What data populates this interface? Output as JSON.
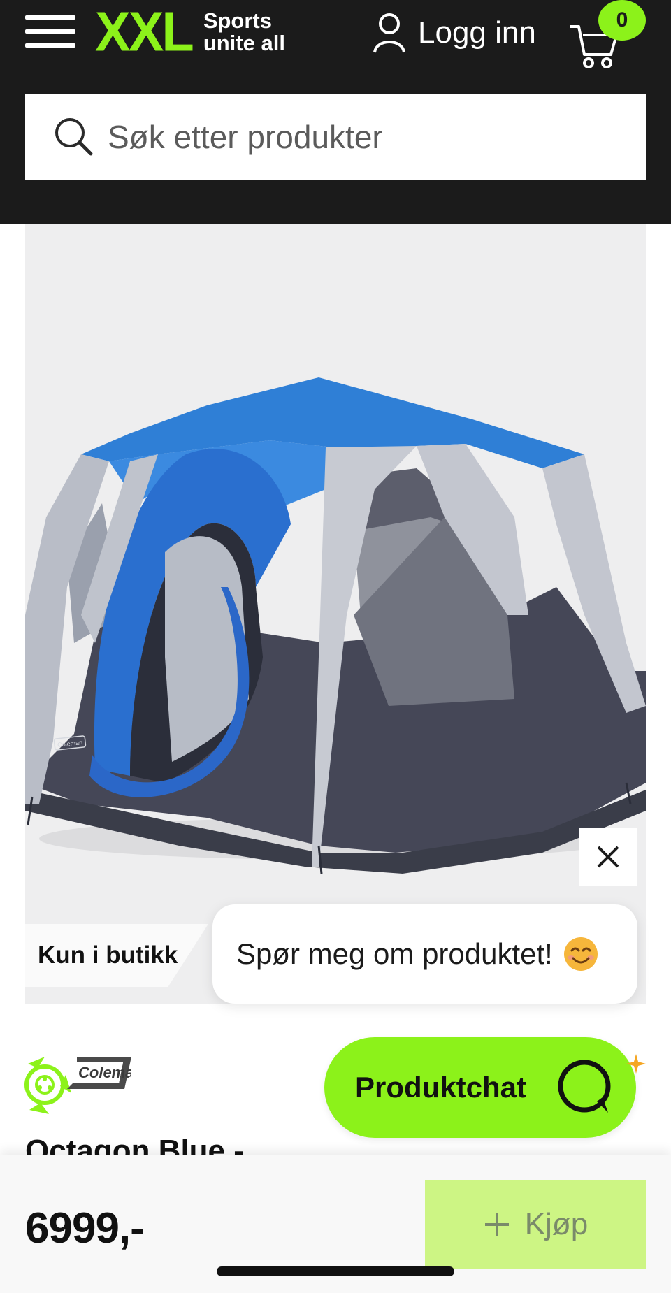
{
  "header": {
    "logo_text": "XXL",
    "tagline_line1": "Sports",
    "tagline_line2": "unite all",
    "login_label": "Logg inn",
    "cart_count": "0"
  },
  "search": {
    "placeholder": "Søk etter produkter"
  },
  "product_image": {
    "store_badge": "Kun i butikk",
    "chat_prompt": "Spør meg om produktet!",
    "tent_brand_print": "Coleman"
  },
  "product": {
    "brand_logo_text": "Coleman",
    "title": "Octagon Blue -",
    "chat_button_label": "Produktchat"
  },
  "bottom_bar": {
    "price": "6999,-",
    "buy_label": "Kjøp"
  },
  "colors": {
    "brand_green": "#8cf21a",
    "header_bg": "#1b1b1b",
    "tent_blue": "#2f7fd6"
  }
}
